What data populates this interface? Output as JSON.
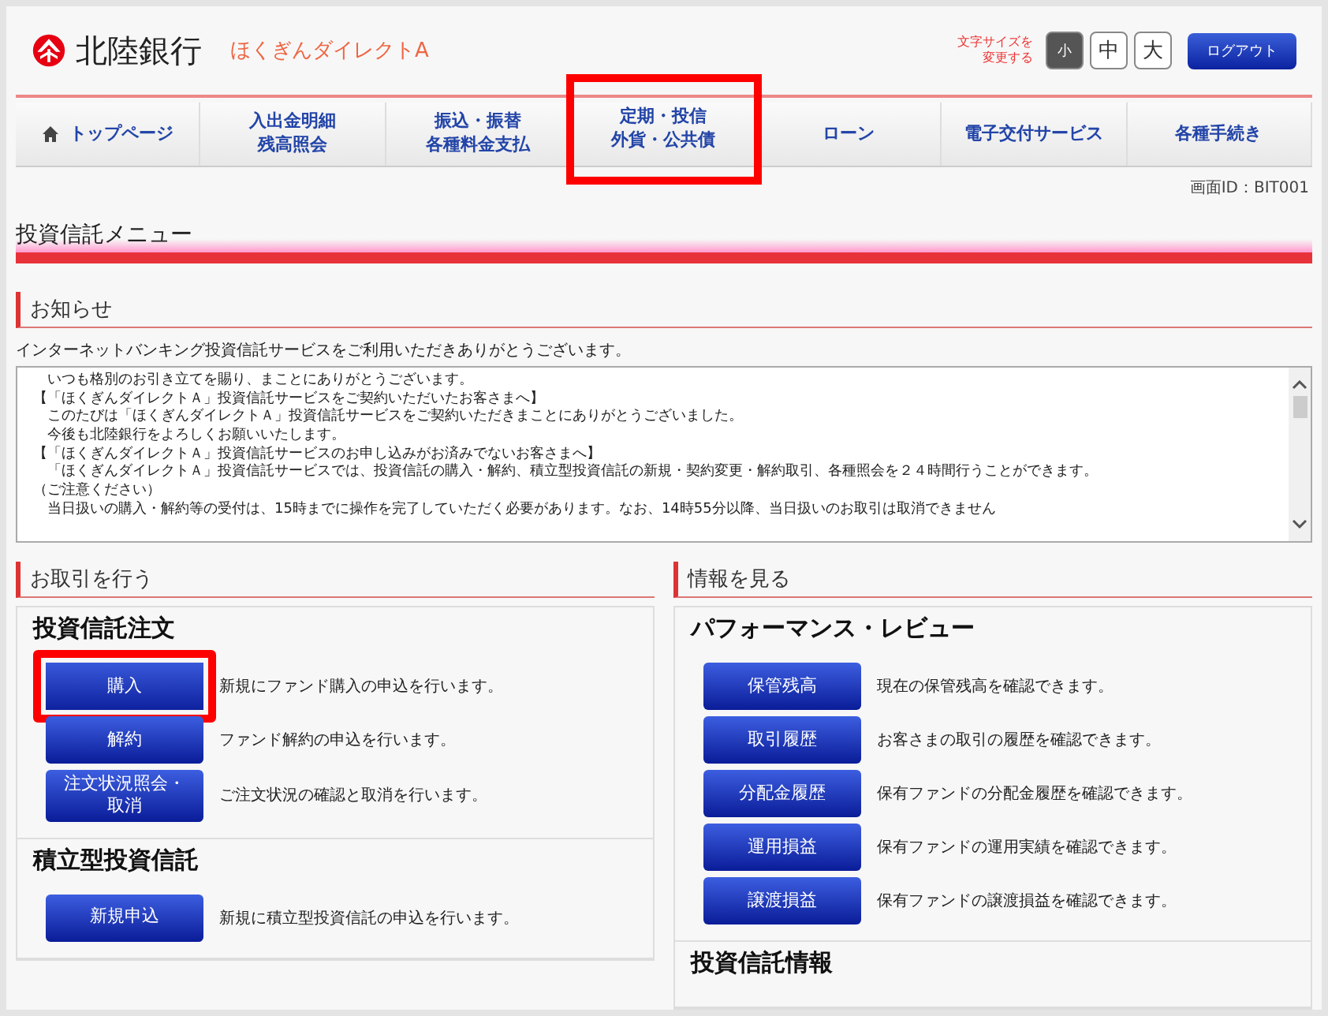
{
  "header": {
    "bank_name": "北陸銀行",
    "service_name": "ほくぎんダイレクトA",
    "font_size_label": "文字サイズを変更する",
    "font_sizes": [
      {
        "label": "小",
        "selected": true
      },
      {
        "label": "中",
        "selected": false
      },
      {
        "label": "大",
        "selected": false
      }
    ],
    "logout": "ログアウト"
  },
  "nav": [
    {
      "lines": [
        "トップページ"
      ],
      "kind": "home",
      "highlighted": false
    },
    {
      "lines": [
        "入出金明細",
        "残高照会"
      ],
      "kind": "text",
      "highlighted": false
    },
    {
      "lines": [
        "振込・振替",
        "各種料金支払"
      ],
      "kind": "text",
      "highlighted": false
    },
    {
      "lines": [
        "定期・投信",
        "外貨・公共債"
      ],
      "kind": "text",
      "highlighted": true
    },
    {
      "lines": [
        "ローン"
      ],
      "kind": "text",
      "highlighted": false
    },
    {
      "lines": [
        "電子交付サービス"
      ],
      "kind": "text",
      "highlighted": false
    },
    {
      "lines": [
        "各種手続き"
      ],
      "kind": "text",
      "highlighted": false
    }
  ],
  "screen_id": "画面ID：BIT001",
  "page_title": "投資信託メニュー",
  "notice": {
    "heading": "お知らせ",
    "intro": "インターネットバンキング投資信託サービスをご利用いただきありがとうございます。",
    "lines": [
      "　いつも格別のお引き立てを賜り、まことにありがとうございます。",
      "【「ほくぎんダイレクトＡ」投資信託サービスをご契約いただいたお客さまへ】",
      "　このたびは「ほくぎんダイレクトＡ」投資信託サービスをご契約いただきまことにありがとうございました。",
      "　今後も北陸銀行をよろしくお願いいたします。",
      "【「ほくぎんダイレクトＡ」投資信託サービスのお申し込みがお済みでないお客さまへ】",
      "　「ほくぎんダイレクトＡ」投資信託サービスでは、投資信託の購入・解約、積立型投資信託の新規・契約変更・解約取引、各種照会を２４時間行うことができます。",
      "（ご注意ください）",
      "　当日扱いの購入・解約等の受付は、15時までに操作を完了していただく必要があります。なお、14時55分以降、当日扱いのお取引は取消できません"
    ]
  },
  "columns": [
    {
      "heading": "お取引を行う",
      "groups": [
        {
          "title": "投資信託注文",
          "items": [
            {
              "button": "購入",
              "description": "新規にファンド購入の申込を行います。",
              "highlighted": true
            },
            {
              "button": "解約",
              "description": "ファンド解約の申込を行います。",
              "highlighted": false
            },
            {
              "button": "注文状況照会・",
              "button_line_2": "取消",
              "description": "ご注文状況の確認と取消を行います。",
              "highlighted": false
            }
          ]
        },
        {
          "title": "積立型投資信託",
          "items": [
            {
              "button": "新規申込",
              "description": "新規に積立型投資信託の申込を行います。",
              "highlighted": false
            }
          ]
        }
      ]
    },
    {
      "heading": "情報を見る",
      "groups": [
        {
          "title": "パフォーマンス・レビュー",
          "items": [
            {
              "button": "保管残高",
              "description": "現在の保管残高を確認できます。",
              "highlighted": false
            },
            {
              "button": "取引履歴",
              "description": "お客さまの取引の履歴を確認できます。",
              "highlighted": false
            },
            {
              "button": "分配金履歴",
              "description": "保有ファンドの分配金履歴を確認できます。",
              "highlighted": false
            },
            {
              "button": "運用損益",
              "description": "保有ファンドの運用実績を確認できます。",
              "highlighted": false
            },
            {
              "button": "譲渡損益",
              "description": "保有ファンドの譲渡損益を確認できます。",
              "highlighted": false
            }
          ]
        },
        {
          "title": "投資信託情報"
        }
      ]
    }
  ]
}
